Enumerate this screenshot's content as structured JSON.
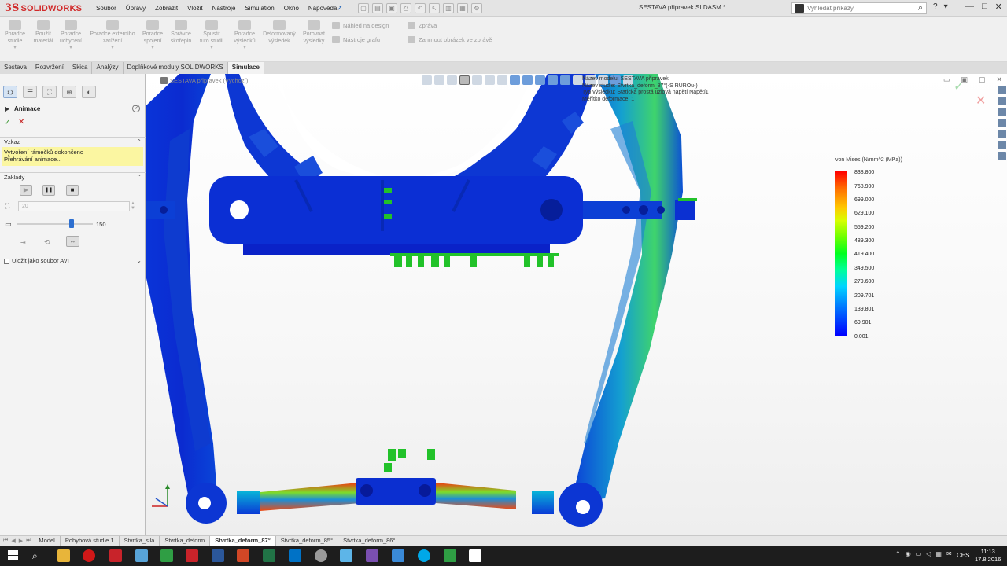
{
  "app": {
    "logo_ds": "3S",
    "logo_name": "SOLIDWORKS",
    "document_title": "SESTAVA připravek.SLDASM *"
  },
  "menus": [
    "Soubor",
    "Úpravy",
    "Zobrazit",
    "Vložit",
    "Nástroje",
    "Simulation",
    "Okno",
    "Nápověda"
  ],
  "search": {
    "placeholder": "Vyhledat příkazy"
  },
  "commands": [
    {
      "label": "Poradce\nstudie"
    },
    {
      "label": "Použít\nmateriál"
    },
    {
      "label": "Poradce\nuchycení"
    },
    {
      "label": "Poradce externího\nzatížení"
    },
    {
      "label": "Poradce\nspojení"
    },
    {
      "label": "Správce\nskořepin"
    },
    {
      "label": "Spustit\ntuto studii"
    },
    {
      "label": "Poradce\nvýsledků"
    },
    {
      "label": "Deformovaný\nvýsledek"
    },
    {
      "label": "Porovnat\nvýsledky"
    }
  ],
  "command_rows": {
    "design_insight": "Náhled na design",
    "plot_tools": "Nástroje grafu",
    "report": "Zpráva",
    "include_image": "Zahrnout obrázek ve zprávě"
  },
  "ribbon_tabs": [
    {
      "label": "Sestava",
      "active": false
    },
    {
      "label": "Rozvržení",
      "active": false
    },
    {
      "label": "Skica",
      "active": false
    },
    {
      "label": "Analýzy",
      "active": false
    },
    {
      "label": "Doplňkové moduly SOLIDWORKS",
      "active": false
    },
    {
      "label": "Simulace",
      "active": true
    }
  ],
  "property_manager": {
    "title": "Animace",
    "help": "?",
    "message_section": "Vzkaz",
    "message_line1": "Vytvoření rámečků dokončeno",
    "message_line2": "Přehrávání animace...",
    "basics_section": "Základy",
    "frames_value": "20",
    "speed_value": "150",
    "save_avi_label": "Uložit jako soubor AVI"
  },
  "viewport": {
    "tree_node": "SESTAVA připravek  (Výchozí)",
    "plot_info": [
      "Název modelu: SESTAVA připravek",
      "Název studie: Stvrtka_deform_87°(-S RUROu-)",
      "Typ výsledku: Statická prostá uzlová napětí Napětí1",
      "Měřítko deformace: 1"
    ]
  },
  "legend": {
    "title": "von Mises (N/mm^2 (MPa))",
    "values": [
      "838.800",
      "768.900",
      "699.000",
      "629.100",
      "559.200",
      "489.300",
      "419.400",
      "349.500",
      "279.600",
      "209.701",
      "139.801",
      "69.901",
      "0.001"
    ],
    "colors": {
      "max": "#ff0000",
      "mid": "#00ff1e",
      "min": "#0000ff"
    }
  },
  "bottom_tabs": [
    {
      "label": "Model",
      "active": false
    },
    {
      "label": "Pohybová studie 1",
      "active": false
    },
    {
      "label": "Stvrtka_sila",
      "active": false
    },
    {
      "label": "Stvrtka_deform",
      "active": false
    },
    {
      "label": "Stvrtka_deform_87°",
      "active": true
    },
    {
      "label": "Stvrtka_deform_85°",
      "active": false
    },
    {
      "label": "Stvrtka_deform_86°",
      "active": false
    }
  ],
  "taskbar": {
    "language": "CES",
    "time": "11:13",
    "date": "17.8.2016"
  },
  "icons": {
    "close": "✕",
    "check": "✓",
    "minimize": "—",
    "maximize": "□",
    "play": "▶",
    "pause": "❚❚",
    "stop": "■"
  }
}
